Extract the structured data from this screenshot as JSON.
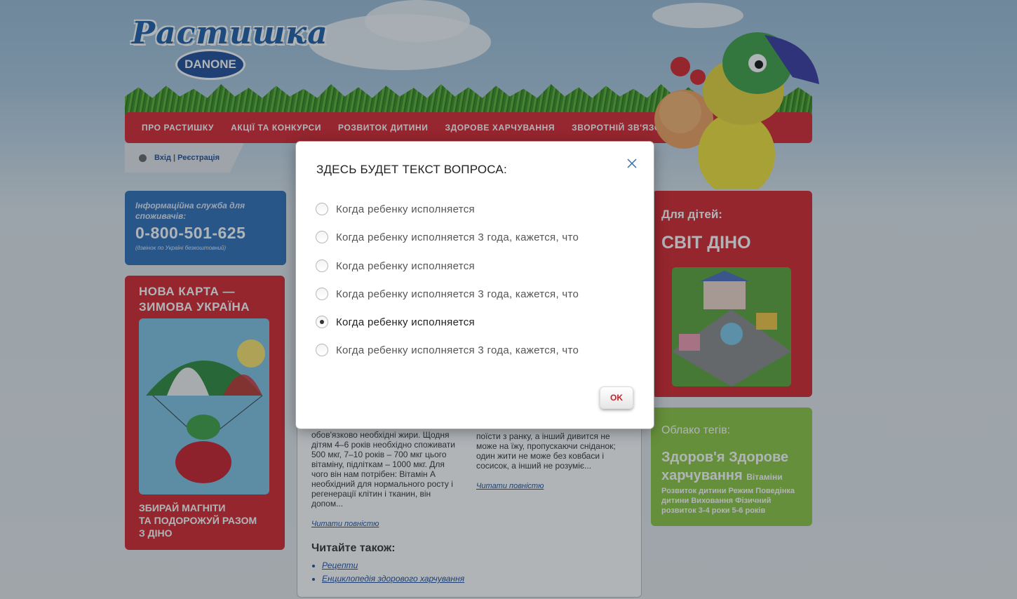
{
  "header": {
    "logo_text": "Растишка",
    "logo_badge": "DANONE"
  },
  "nav": {
    "items": [
      {
        "label": "ПРО РАСТИШКУ"
      },
      {
        "label": "АКЦІЇ ТА КОНКУРСИ"
      },
      {
        "label": "РОЗВИТОК ДИТИНИ"
      },
      {
        "label": "ЗДОРОВЕ ХАРЧУВАННЯ"
      },
      {
        "label": "ЗВОРОТНІЙ ЗВ'ЯЗОК"
      }
    ]
  },
  "auth": {
    "login": "Вхід",
    "separator": " | ",
    "register": "Реєстрація"
  },
  "info": {
    "title": "Інформаційна служба для споживачів:",
    "phone": "0-800-501-625",
    "note": "(дзвінок по Україні безкоштовний)"
  },
  "map_promo": {
    "title_line1": "НОВА КАРТА —",
    "title_line2": "ЗИМОВА УКРАЇНА",
    "cap_line1": "ЗБИРАЙ МАГНІТИ",
    "cap_line2": "ТА ПОДОРОЖУЙ РАЗОМ",
    "cap_line3": "З ДІНО"
  },
  "article": {
    "col1_lines": [
      "обов'язково необхідні жири. Щодня",
      "дітям 4–6 років необхідно споживати",
      "500 мкг, 7–10 років – 700 мкг цього",
      "вітаміну, підліткам – 1000 мкг. Для",
      "чого він нам потрібен: Вітамін А",
      "необхідний для нормального росту і",
      "регенерації клітин і тканин, він",
      "допом..."
    ],
    "col2_lines": [
      "поїсти з ранку, а інший дивится не",
      "може на їжу, пропускаючи сніданок;",
      "один жити не може без ковбаси і",
      "сосисок, а інший не розуміє..."
    ],
    "read_more": "Читати повністю",
    "also_title": "Читайте також:",
    "also_links": [
      "Рецепти",
      "Енциклопедія здорового харчування"
    ]
  },
  "dino": {
    "kicker": "Для дітей:",
    "title": "СВІТ ДІНО"
  },
  "tags": {
    "title": "Облако тегів:",
    "big": "Здоров'я Здорове харчування",
    "mid": "Вітаміни",
    "small": "Розвиток дитини Режим Поведінка дитини Виховання Фізичний розвиток 3-4 роки 5-6 років"
  },
  "modal": {
    "question": "ЗДЕСЬ БУДЕТ ТЕКСТ ВОПРОСА:",
    "options": [
      {
        "label": "Когда ребенку исполняется",
        "checked": false
      },
      {
        "label": "Когда ребенку исполняется 3 года, кажется, что",
        "checked": false
      },
      {
        "label": "Когда ребенку исполняется",
        "checked": false
      },
      {
        "label": "Когда ребенку исполняется 3 года, кажется, что",
        "checked": false
      },
      {
        "label": "Когда ребенку исполняется",
        "checked": true
      },
      {
        "label": "Когда ребенку исполняется 3 года, кажется, что",
        "checked": false
      }
    ],
    "ok_label": "OK",
    "accent_color": "#c9202a"
  }
}
